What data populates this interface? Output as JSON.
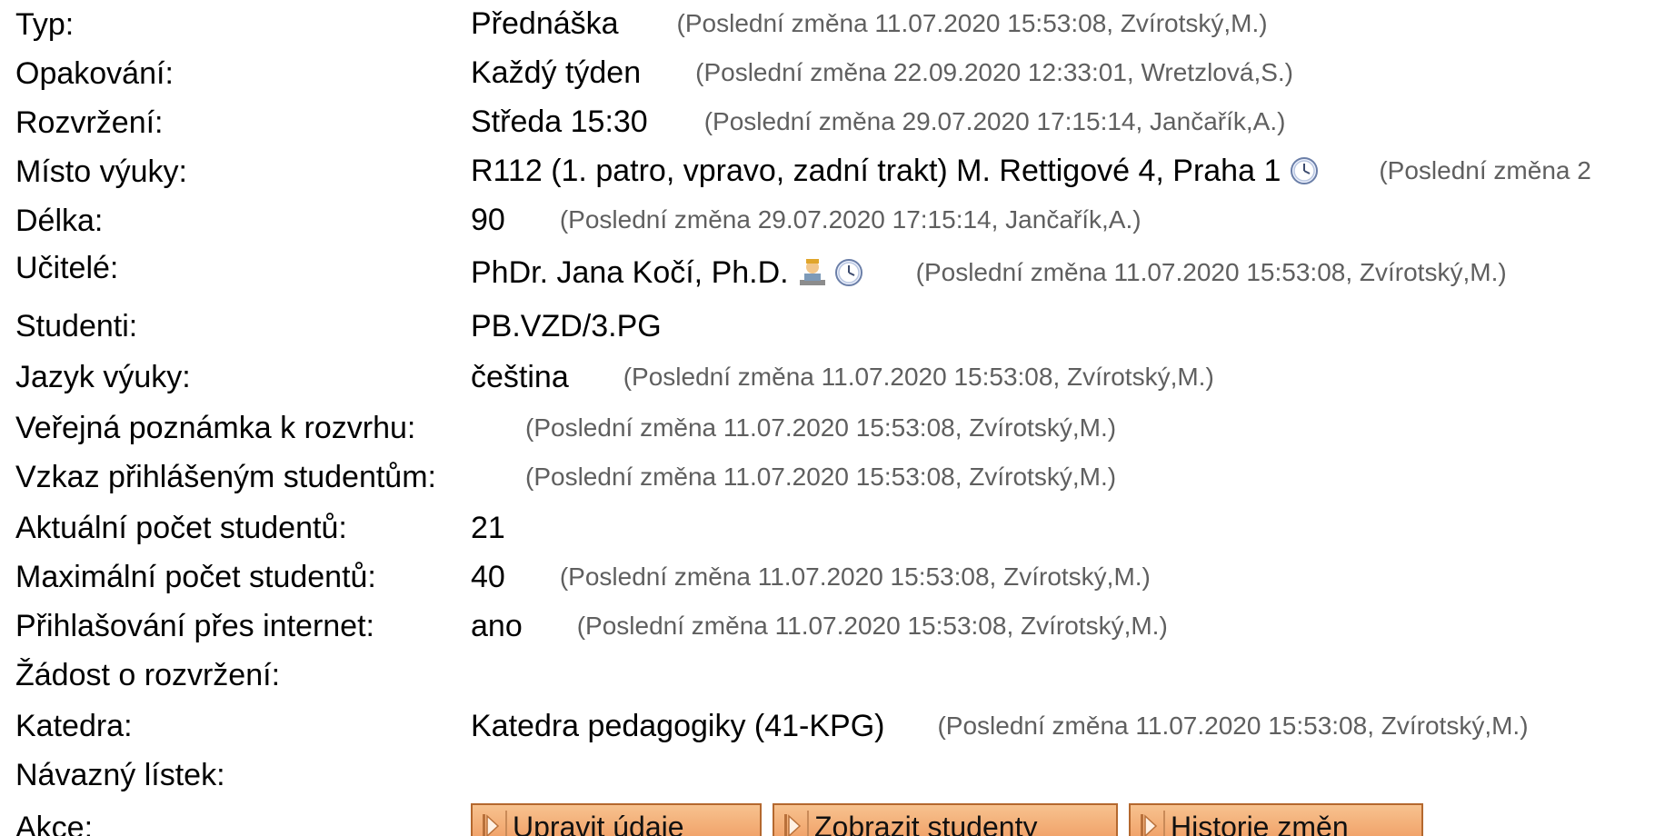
{
  "rows": [
    {
      "label": "Typ:",
      "value": "Přednáška",
      "change": "(Poslední změna 11.07.2020 15:53:08, Zvírotský,M.)"
    },
    {
      "label": "Opakování:",
      "value": "Každý týden",
      "change": "(Poslední změna 22.09.2020 12:33:01, Wretzlová,S.)"
    },
    {
      "label": "Rozvržení:",
      "value": "Středa 15:30",
      "change": "(Poslední změna 29.07.2020 17:15:14, Jančařík,A.)"
    },
    {
      "label": "Místo výuky:",
      "value": "R112 (1. patro, vpravo, zadní trakt) M. Rettigové 4, Praha 1",
      "change": "(Poslední změna 2"
    },
    {
      "label": "Délka:",
      "value": "90",
      "change": "(Poslední změna 29.07.2020 17:15:14, Jančařík,A.)"
    },
    {
      "label": "Učitelé:",
      "value": "PhDr. Jana Kočí, Ph.D.",
      "change": "(Poslední změna 11.07.2020 15:53:08, Zvírotský,M.)"
    },
    {
      "label": "Studenti:",
      "value": "PB.VZD/3.PG",
      "change": ""
    },
    {
      "label": "Jazyk výuky:",
      "value": "čeština",
      "change": "(Poslední změna 11.07.2020 15:53:08, Zvírotský,M.)"
    },
    {
      "label": "Veřejná poznámka k rozvrhu:",
      "value": "",
      "change": "(Poslední změna 11.07.2020 15:53:08, Zvírotský,M.)"
    },
    {
      "label": "Vzkaz přihlášeným studentům:",
      "value": "",
      "change": "(Poslední změna 11.07.2020 15:53:08, Zvírotský,M.)"
    },
    {
      "label": "Aktuální počet studentů:",
      "value": "21",
      "change": ""
    },
    {
      "label": "Maximální počet studentů:",
      "value": "40",
      "change": "(Poslední změna 11.07.2020 15:53:08, Zvírotský,M.)"
    },
    {
      "label": "Přihlašování přes internet:",
      "value": "ano",
      "change": "(Poslední změna 11.07.2020 15:53:08, Zvírotský,M.)"
    },
    {
      "label": "Žádost o rozvržení:",
      "value": "",
      "change": ""
    },
    {
      "label": "Katedra:",
      "value": "Katedra pedagogiky (41-KPG)",
      "change": "(Poslední změna 11.07.2020 15:53:08, Zvírotský,M.)"
    },
    {
      "label": "Návazný lístek:",
      "value": "",
      "change": ""
    }
  ],
  "actions": {
    "label": "Akce:",
    "buttons": [
      "Upravit údaje",
      "Zobrazit studenty",
      "Historie změn"
    ]
  },
  "icons": {
    "clock": "clock-icon",
    "teacher": "teacher-icon",
    "button": "play-step-icon"
  },
  "colors": {
    "change_text": "#5f5f5f",
    "button_top": "#f7c28f",
    "button_bottom": "#ee9458",
    "button_border": "#b4682e"
  }
}
